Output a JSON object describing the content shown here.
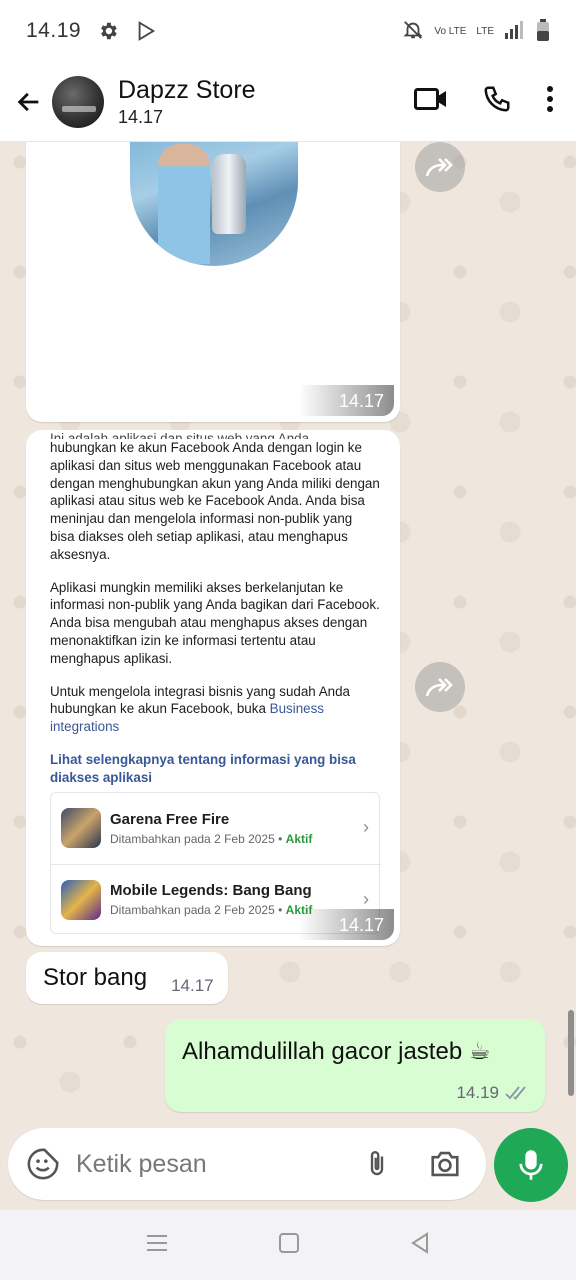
{
  "status": {
    "time": "14.19",
    "network": "Vo LTE",
    "network2": "LTE"
  },
  "header": {
    "contact_name": "Dapzz Store",
    "last_seen": "14.17"
  },
  "messages": {
    "media1_time": "14.17",
    "media2_time": "14.17",
    "doc": {
      "cut_line": "Ini adalah aplikasi dan situs web yang Anda",
      "para1": "hubungkan ke akun Facebook Anda dengan login ke aplikasi dan situs web menggunakan Facebook atau dengan menghubungkan akun yang Anda miliki dengan aplikasi atau situs web ke Facebook Anda. Anda bisa meninjau dan mengelola informasi non-publik yang bisa diakses oleh setiap aplikasi, atau menghapus aksesnya.",
      "para2": "Aplikasi mungkin memiliki akses berkelanjutan ke informasi non-publik yang Anda bagikan dari Facebook. Anda bisa mengubah atau menghapus akses dengan menonaktifkan izin ke informasi tertentu atau menghapus aplikasi.",
      "para3": "Untuk mengelola integrasi bisnis yang sudah Anda hubungkan ke akun Facebook, buka",
      "para3_link": "Business integrations",
      "see_more": "Lihat selengkapnya tentang informasi yang bisa diakses aplikasi",
      "apps": [
        {
          "name": "Garena Free Fire",
          "added": "Ditambahkan pada 2 Feb 2025",
          "status": "Aktif"
        },
        {
          "name": "Mobile Legends: Bang Bang",
          "added": "Ditambahkan pada 2 Feb 2025",
          "status": "Aktif"
        }
      ]
    },
    "incoming_text": "Stor bang",
    "incoming_time": "14.17",
    "outgoing_text": "Alhamdulillah gacor jasteb ☕",
    "outgoing_time": "14.19"
  },
  "composer": {
    "placeholder": "Ketik pesan"
  },
  "colors": {
    "accent": "#1fa855",
    "outgoing_bubble": "#d9fdd3",
    "chat_bg": "#efe7de",
    "active_green": "#2c9a3b"
  }
}
